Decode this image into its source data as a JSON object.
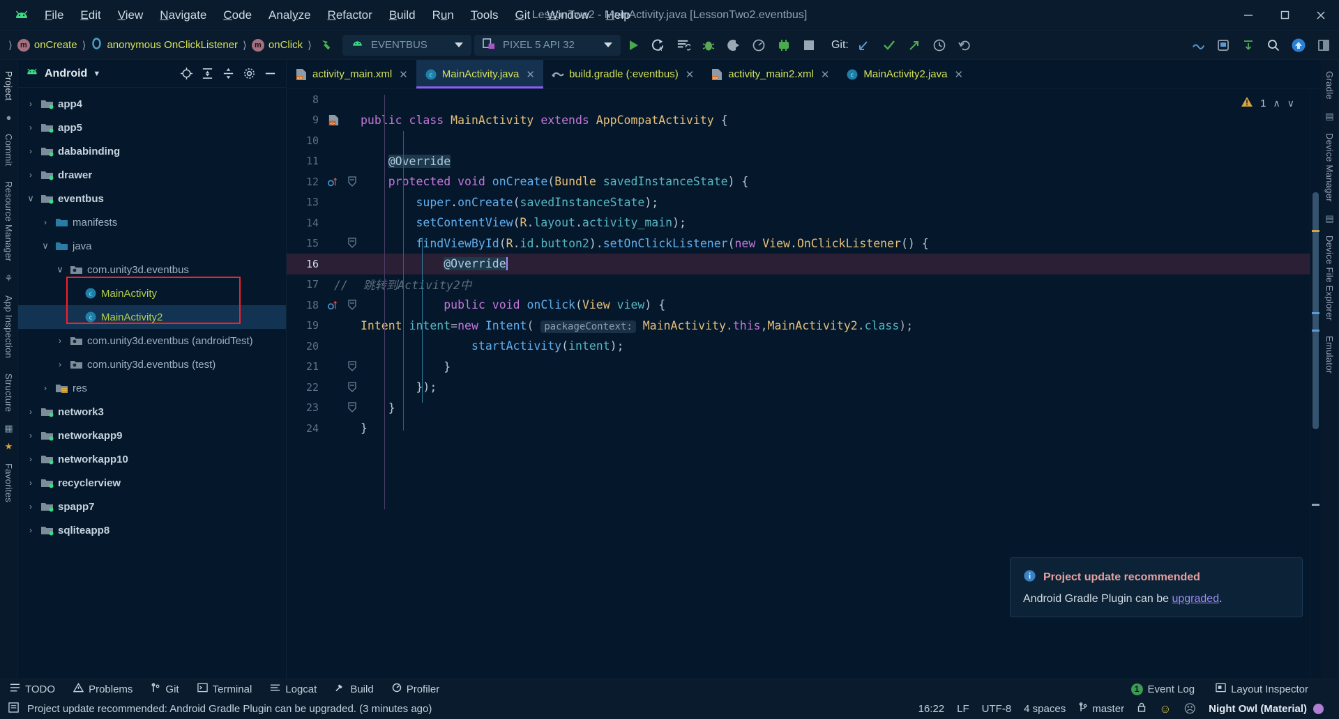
{
  "window": {
    "title": "LessonTwo2 - MainActivity.java [LessonTwo2.eventbus]",
    "minimize": "─",
    "maximize": "❐",
    "close": "✕",
    "logo_icon": "android-logo-icon"
  },
  "menubar": [
    {
      "label": "File",
      "mnemonic": "F"
    },
    {
      "label": "Edit",
      "mnemonic": "E"
    },
    {
      "label": "View",
      "mnemonic": "V"
    },
    {
      "label": "Navigate",
      "mnemonic": "N"
    },
    {
      "label": "Code",
      "mnemonic": "C"
    },
    {
      "label": "Analyze",
      "mnemonic": "y"
    },
    {
      "label": "Refactor",
      "mnemonic": "R"
    },
    {
      "label": "Build",
      "mnemonic": "B"
    },
    {
      "label": "Run",
      "mnemonic": "u"
    },
    {
      "label": "Tools",
      "mnemonic": "T"
    },
    {
      "label": "Git",
      "mnemonic": "G"
    },
    {
      "label": "Window",
      "mnemonic": "W"
    },
    {
      "label": "Help",
      "mnemonic": "H"
    }
  ],
  "toolbar": {
    "breadcrumbs": [
      {
        "label": "onCreate",
        "icon": "method-icon"
      },
      {
        "label": "anonymous OnClickListener",
        "icon": "class-interface-icon"
      },
      {
        "label": "onClick",
        "icon": "method-icon"
      }
    ],
    "separator": "〉",
    "build_icon": "hammer-icon",
    "run_config": "EVENTBUS",
    "device": "PIXEL 5 API 32",
    "git_label": "Git:",
    "buttons": [
      "run-icon",
      "apply-changes-icon",
      "apply-code-changes-icon",
      "debug-icon",
      "attach-debugger-icon",
      "profiler-icon",
      "device-manager-icon",
      "stop-icon"
    ],
    "git_buttons": [
      "update-project-icon",
      "commit-icon",
      "push-icon",
      "history-icon",
      "rollback-icon"
    ],
    "right_buttons": [
      "sdk-manager-icon",
      "avd-manager-icon",
      "sync-gradle-icon",
      "search-icon",
      "update-icon",
      "layout-icon"
    ]
  },
  "left_rail": [
    "Project",
    "Commit",
    "Resource Manager",
    "App Inspection",
    "Structure",
    "Favorites"
  ],
  "right_rail": [
    "Gradle",
    "Device Manager",
    "Device File Explorer",
    "Emulator"
  ],
  "project_panel": {
    "title": "Android",
    "dropdown_icon": "chevron-down-icon",
    "tools": [
      "select-opened-file-icon",
      "expand-all-icon",
      "collapse-all-icon",
      "settings-icon",
      "hide-icon"
    ],
    "tree": [
      {
        "label": "app4",
        "depth": 0,
        "arrow": "›",
        "icon": "module-folder-icon",
        "style": "bold"
      },
      {
        "label": "app5",
        "depth": 0,
        "arrow": "›",
        "icon": "module-folder-icon",
        "style": "bold"
      },
      {
        "label": "dababinding",
        "depth": 0,
        "arrow": "›",
        "icon": "module-folder-icon",
        "style": "bold"
      },
      {
        "label": "drawer",
        "depth": 0,
        "arrow": "›",
        "icon": "module-folder-icon",
        "style": "bold"
      },
      {
        "label": "eventbus",
        "depth": 0,
        "arrow": "∨",
        "icon": "module-folder-icon",
        "style": "bold"
      },
      {
        "label": "manifests",
        "depth": 1,
        "arrow": "›",
        "icon": "folder-icon",
        "style": "normal"
      },
      {
        "label": "java",
        "depth": 1,
        "arrow": "∨",
        "icon": "folder-icon",
        "style": "normal"
      },
      {
        "label": "com.unity3d.eventbus",
        "depth": 2,
        "arrow": "∨",
        "icon": "package-icon",
        "style": "normal"
      },
      {
        "label": "MainActivity",
        "depth": 3,
        "arrow": "",
        "icon": "java-class-icon",
        "style": "class"
      },
      {
        "label": "MainActivity2",
        "depth": 3,
        "arrow": "",
        "icon": "java-class-icon",
        "style": "class",
        "selected": true
      },
      {
        "label": "com.unity3d.eventbus (androidTest)",
        "depth": 2,
        "arrow": "›",
        "icon": "package-icon",
        "style": "normal"
      },
      {
        "label": "com.unity3d.eventbus (test)",
        "depth": 2,
        "arrow": "›",
        "icon": "package-icon",
        "style": "normal"
      },
      {
        "label": "res",
        "depth": 1,
        "arrow": "›",
        "icon": "res-folder-icon",
        "style": "normal"
      },
      {
        "label": "network3",
        "depth": 0,
        "arrow": "›",
        "icon": "module-folder-icon",
        "style": "bold"
      },
      {
        "label": "networkapp9",
        "depth": 0,
        "arrow": "›",
        "icon": "module-folder-icon",
        "style": "bold"
      },
      {
        "label": "networkapp10",
        "depth": 0,
        "arrow": "›",
        "icon": "module-folder-icon",
        "style": "bold"
      },
      {
        "label": "recyclerview",
        "depth": 0,
        "arrow": "›",
        "icon": "module-folder-icon",
        "style": "bold"
      },
      {
        "label": "spapp7",
        "depth": 0,
        "arrow": "›",
        "icon": "module-folder-icon",
        "style": "bold"
      },
      {
        "label": "sqliteapp8",
        "depth": 0,
        "arrow": "›",
        "icon": "module-folder-icon",
        "style": "bold"
      }
    ]
  },
  "editor": {
    "tabs": [
      {
        "label": "activity_main.xml",
        "icon": "xml-layout-icon",
        "active": false
      },
      {
        "label": "MainActivity.java",
        "icon": "java-class-icon",
        "active": true
      },
      {
        "label": "build.gradle (:eventbus)",
        "icon": "gradle-icon",
        "active": false
      },
      {
        "label": "activity_main2.xml",
        "icon": "xml-layout-icon",
        "active": false
      },
      {
        "label": "MainActivity2.java",
        "icon": "java-class-icon",
        "active": false
      }
    ],
    "close_glyph": "✕",
    "warning_count": "1",
    "warning_icon": "warning-triangle-icon",
    "nav_up": "∧",
    "nav_down": "∨",
    "current_line": 16,
    "lines": [
      {
        "no": 8,
        "text": ""
      },
      {
        "no": 9,
        "text": "public class MainActivity extends AppCompatActivity {",
        "gutter": "bookmark-icon"
      },
      {
        "no": 10,
        "text": ""
      },
      {
        "no": 11,
        "text": "    @Override"
      },
      {
        "no": 12,
        "text": "    protected void onCreate(Bundle savedInstanceState) {",
        "gutter": "override-method-icon",
        "fold": true
      },
      {
        "no": 13,
        "text": "        super.onCreate(savedInstanceState);"
      },
      {
        "no": 14,
        "text": "        setContentView(R.layout.activity_main);"
      },
      {
        "no": 15,
        "text": "        findViewById(R.id.button2).setOnClickListener(new View.OnClickListener() {",
        "fold": true
      },
      {
        "no": 16,
        "text": "            @Override",
        "current": true
      },
      {
        "no": 17,
        "text": "            跳转到Activity2中",
        "comment_mark": "//"
      },
      {
        "no": 18,
        "text": "            public void onClick(View view) {",
        "gutter": "override-method-icon",
        "fold": true
      },
      {
        "no": 19,
        "text": "                Intent intent=new Intent( packageContext: MainActivity.this,MainActivity2.class);"
      },
      {
        "no": 20,
        "text": "                startActivity(intent);"
      },
      {
        "no": 21,
        "text": "            }",
        "fold": true
      },
      {
        "no": 22,
        "text": "        });",
        "fold": true
      },
      {
        "no": 23,
        "text": "    }",
        "fold": true
      },
      {
        "no": 24,
        "text": "}"
      }
    ],
    "param_hint": "packageContext:"
  },
  "notification": {
    "icon": "info-icon",
    "title": "Project update recommended",
    "body_prefix": "Android Gradle Plugin can be ",
    "body_link": "upgraded",
    "body_suffix": "."
  },
  "tool_windows": {
    "left": [
      {
        "label": "TODO",
        "icon": "todo-icon"
      },
      {
        "label": "Problems",
        "icon": "problems-icon"
      },
      {
        "label": "Git",
        "icon": "git-icon"
      },
      {
        "label": "Terminal",
        "icon": "terminal-icon"
      },
      {
        "label": "Logcat",
        "icon": "logcat-icon"
      },
      {
        "label": "Build",
        "icon": "build-hammer-icon"
      },
      {
        "label": "Profiler",
        "icon": "profiler-icon"
      }
    ],
    "right": [
      {
        "label": "Event Log",
        "icon": "event-log-icon",
        "badge": "1"
      },
      {
        "label": "Layout Inspector",
        "icon": "layout-inspector-icon"
      }
    ]
  },
  "status_bar": {
    "message_icon": "status-info-icon",
    "message": "Project update recommended: Android Gradle Plugin can be upgraded. (3 minutes ago)",
    "time": "16:22",
    "line_separator": "LF",
    "encoding": "UTF-8",
    "indent": "4 spaces",
    "branch": "master",
    "branch_icon": "git-branch-icon",
    "lock_icon": "lock-icon",
    "happy_icon": "☺",
    "sad_icon": "☹",
    "theme": "Night Owl (Material)",
    "theme_dot_color": "#b07fd4"
  },
  "colors": {
    "accent_purple": "#8b5cf6",
    "highlight_red": "#f5222d",
    "android_green": "#3ddc84",
    "class_green": "#b5cf4b"
  }
}
